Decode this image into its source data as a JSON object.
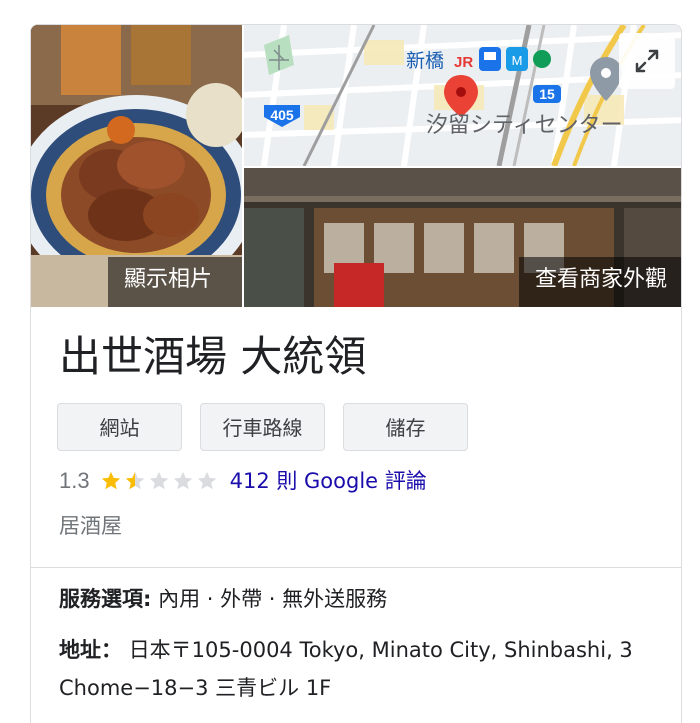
{
  "media": {
    "photos_label": "顯示相片",
    "street_view_label": "查看商家外觀",
    "map": {
      "station_label": "新橋",
      "rail_badge": "JR",
      "road_405": "405",
      "road_15": "15",
      "area_label": "汐留シティセンター"
    },
    "icons": {
      "expand": "expand-icon",
      "pin": "map-pin-icon"
    }
  },
  "business": {
    "name": "出世酒場 大統領",
    "actions": {
      "website": "網站",
      "directions": "行車路線",
      "save": "儲存"
    },
    "rating": {
      "value": "1.3",
      "stars": 1.5,
      "max_stars": 5,
      "reviews_text": "412 則 Google 評論"
    },
    "category": "居酒屋"
  },
  "details": {
    "services_label": "服務選項:",
    "services_value": "內用 · 外帶 · 無外送服務",
    "address_label": "地址：",
    "address_value": "日本〒105-0004 Tokyo, Minato City, Shinbashi, 3 Chome−18−3 三青ビル 1F"
  },
  "colors": {
    "star_filled": "#fbbc04",
    "star_empty": "#dadce0",
    "link": "#1a0dab",
    "pin": "#ea4335"
  }
}
